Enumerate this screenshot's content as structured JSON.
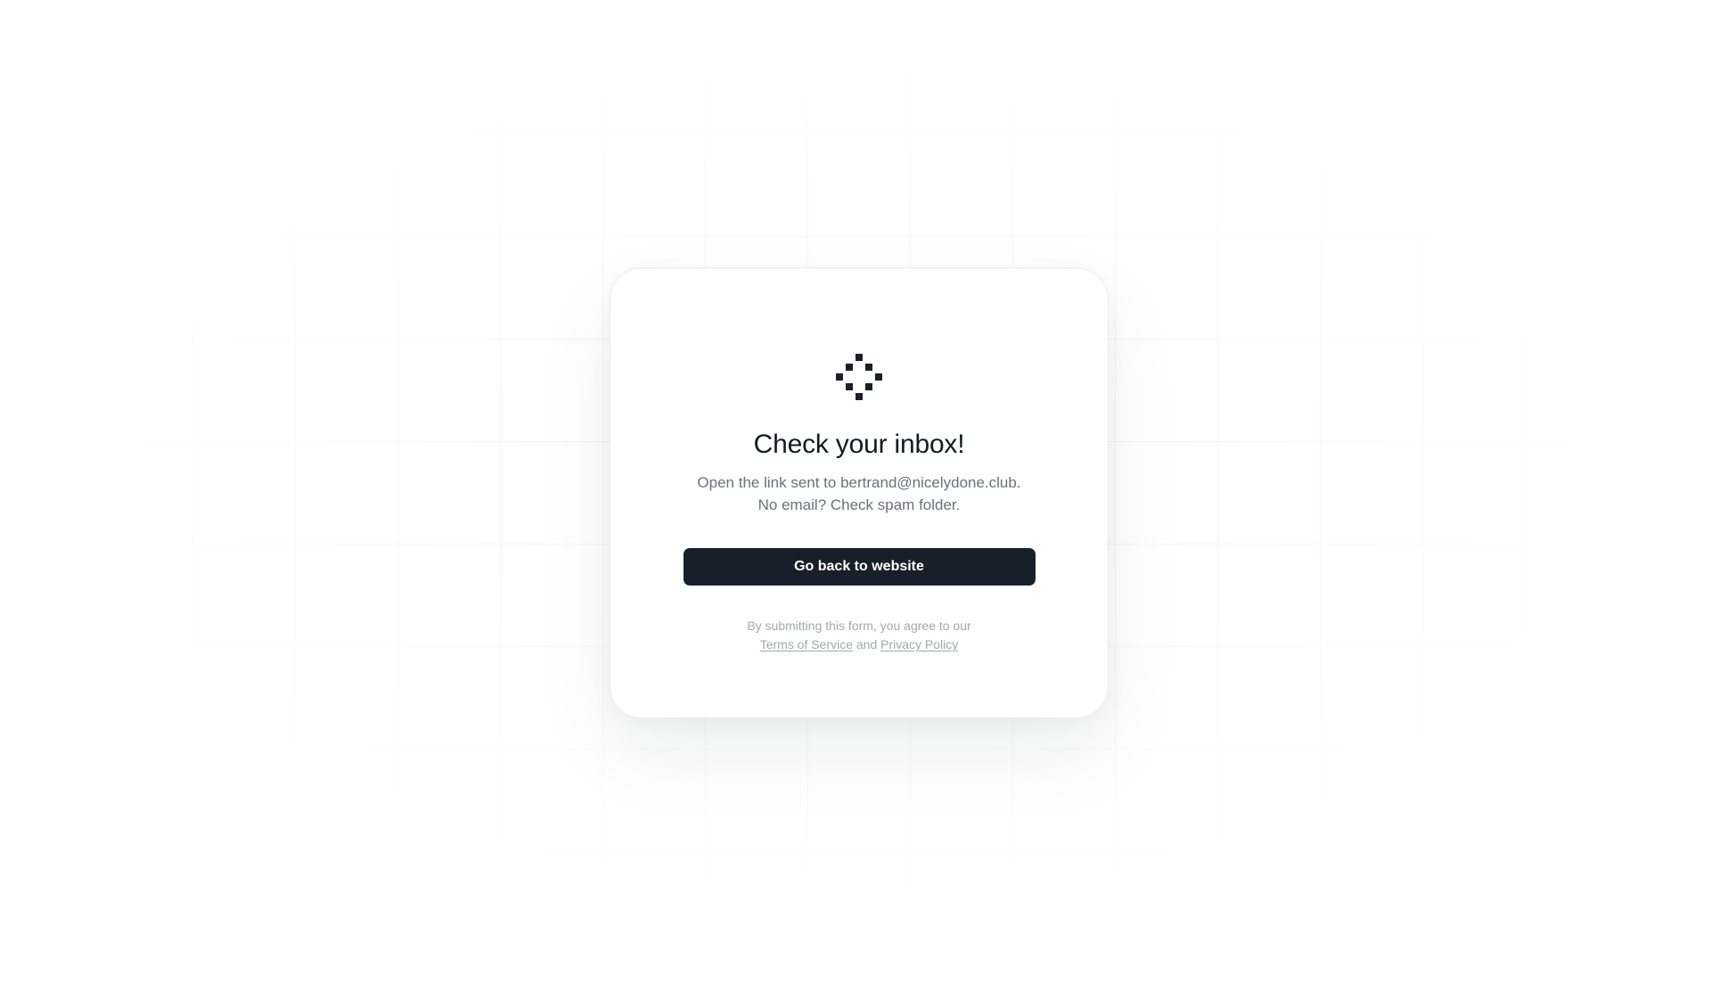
{
  "card": {
    "logo_icon": "pixel-diamond-logo-icon",
    "title": "Check your inbox!",
    "subtitle_line1": "Open the link sent to bertrand@nicelydone.club.",
    "subtitle_line2": "No email? Check spam folder.",
    "cta_label": "Go back to website",
    "legal": {
      "prefix": "By submitting this form, you agree to our",
      "terms_label": "Terms of Service",
      "conjunction": "and",
      "privacy_label": "Privacy Policy"
    }
  },
  "colors": {
    "text_primary": "#141a22",
    "text_secondary": "#6b7079",
    "text_muted": "#a3a7ae",
    "button_bg": "#17202a",
    "button_text": "#ffffff",
    "logo": "#1b2028"
  }
}
